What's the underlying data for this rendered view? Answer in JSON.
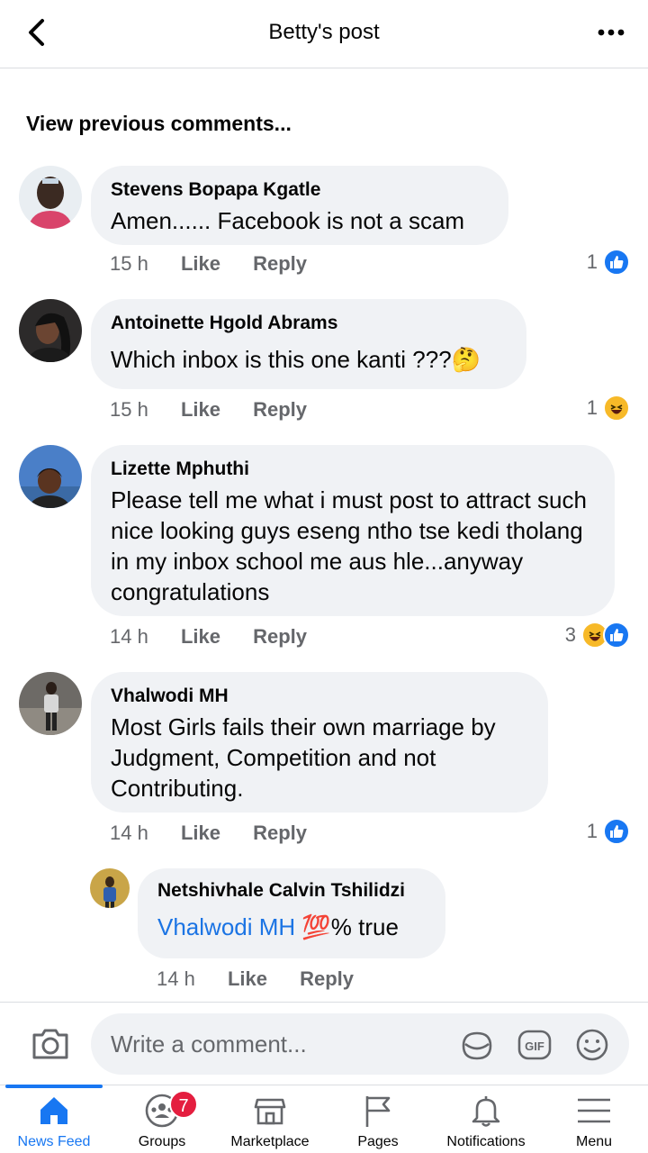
{
  "header": {
    "title": "Betty's post"
  },
  "comments_link": "View previous comments...",
  "comments": [
    {
      "name": "Stevens Bopapa Kgatle",
      "text": "Amen...... Facebook is not a scam",
      "time": "15 h",
      "like": "Like",
      "reply": "Reply",
      "reaction_count": "1",
      "reactions": [
        "like"
      ]
    },
    {
      "name": "Antoinette Hgold Abrams",
      "text": "Which inbox is this one kanti ???🤔",
      "time": "15 h",
      "like": "Like",
      "reply": "Reply",
      "reaction_count": "1",
      "reactions": [
        "haha"
      ]
    },
    {
      "name": "Lizette Mphuthi",
      "text": "Please tell me what i must post to attract such nice looking guys eseng ntho tse kedi tholang in my inbox school me aus hle...anyway congratulations",
      "time": "14 h",
      "like": "Like",
      "reply": "Reply",
      "reaction_count": "3",
      "reactions": [
        "haha",
        "like"
      ]
    },
    {
      "name": "Vhalwodi MH",
      "text": "Most Girls fails their own marriage by Judgment, Competition and not Contributing.",
      "time": "14 h",
      "like": "Like",
      "reply": "Reply",
      "reaction_count": "1",
      "reactions": [
        "like"
      ]
    }
  ],
  "reply": {
    "name": "Netshivhale Calvin Tshilidzi",
    "mention": "Vhalwodi MH",
    "text": " 💯% true",
    "time": "14 h",
    "like": "Like",
    "reply": "Reply"
  },
  "composer": {
    "placeholder": "Write a comment...",
    "icons": [
      "camera-icon",
      "sticker-icon",
      "gif-icon",
      "emoji-icon"
    ]
  },
  "tabbar": {
    "tabs": [
      {
        "label": "News Feed",
        "icon": "home-icon",
        "active": true
      },
      {
        "label": "Groups",
        "icon": "groups-icon",
        "badge": "7"
      },
      {
        "label": "Marketplace",
        "icon": "marketplace-icon"
      },
      {
        "label": "Pages",
        "icon": "flag-icon"
      },
      {
        "label": "Notifications",
        "icon": "bell-icon"
      },
      {
        "label": "Menu",
        "icon": "menu-icon"
      }
    ]
  },
  "colors": {
    "accent": "#1877f2",
    "bubble": "#f0f2f5",
    "secondary_text": "#65676b",
    "badge": "#e41e3f"
  }
}
